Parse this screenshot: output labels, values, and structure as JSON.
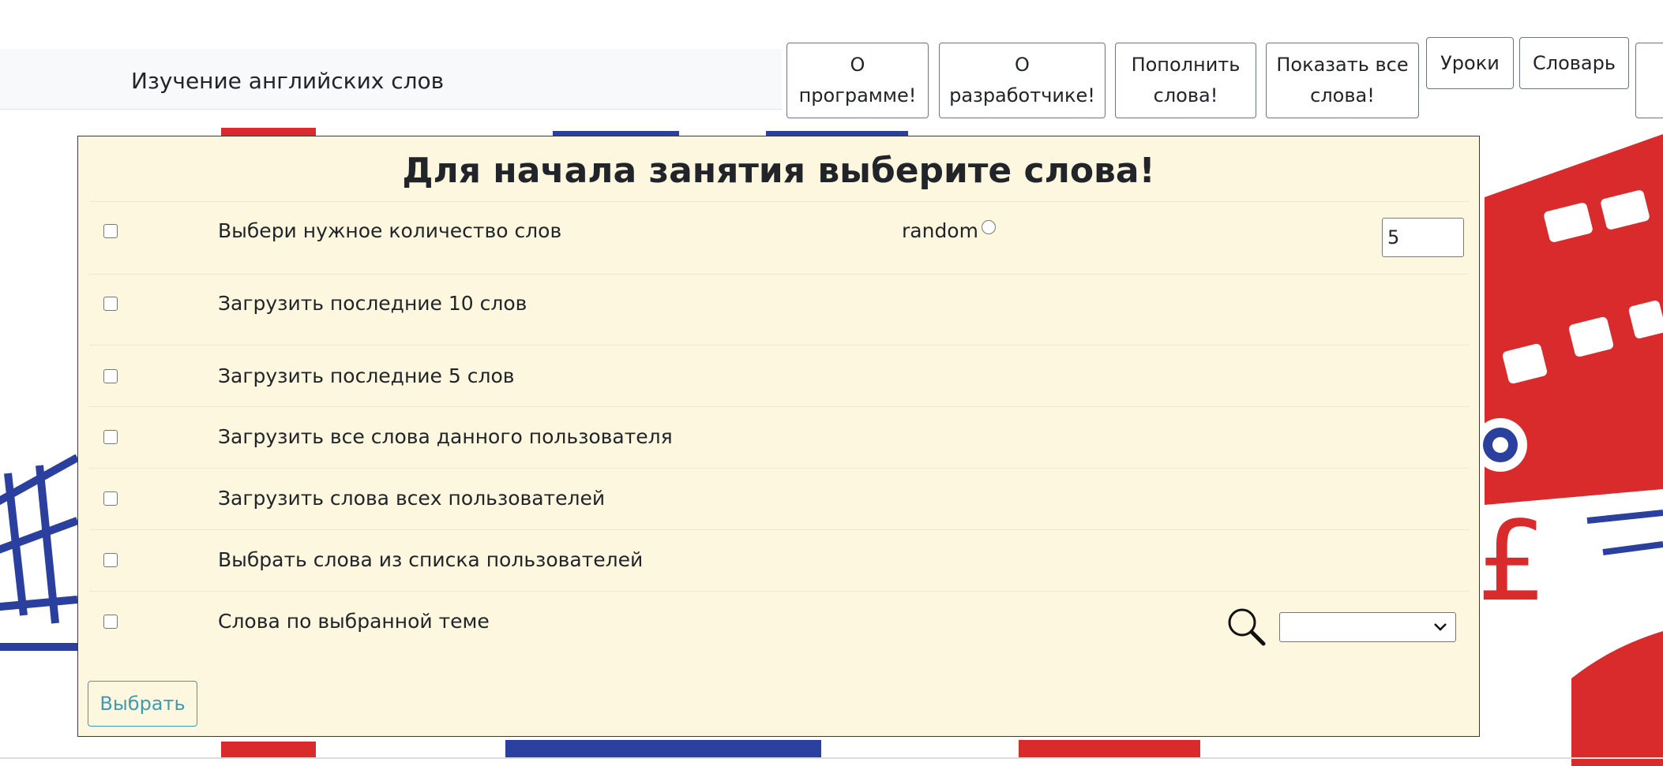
{
  "app": {
    "title": "Изучение английских слов"
  },
  "nav": {
    "about_program": "О программе!",
    "about_developer": "О разработчике!",
    "add_words": "Пополнить слова!",
    "show_all_words": "Показать все слова!",
    "lessons": "Уроки",
    "dictionary": "Словарь"
  },
  "panel": {
    "title": "Для начала занятия выберите слова!",
    "options": [
      {
        "label": "Выбери нужное количество слов"
      },
      {
        "label": "Загрузить последние 10 слов"
      },
      {
        "label": "Загрузить последние 5 слов"
      },
      {
        "label": "Загрузить все слова данного пользователя"
      },
      {
        "label": "Загрузить слова всех пользователей"
      },
      {
        "label": "Выбрать слова из списка пользователей"
      },
      {
        "label": "Слова по выбранной теме"
      }
    ],
    "random_label": "random",
    "count_value": "5",
    "topic_selected": "",
    "submit_label": "Выбрать"
  },
  "colors": {
    "panel_bg": "#fdf7df",
    "accent_red": "#d92b2b",
    "accent_blue": "#2a3f9e",
    "submit_teal": "#3f9bb0"
  },
  "icons": {
    "search": "magnifier-icon",
    "dropdown": "chevron-down-icon"
  }
}
